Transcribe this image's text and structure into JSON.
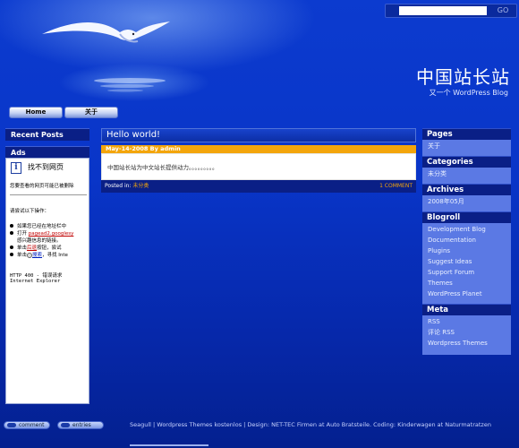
{
  "header": {
    "site_title": "中国站长站",
    "tagline": "又一个 WordPress Blog",
    "search_go": "GO"
  },
  "nav": {
    "home": "Home",
    "about": "关于"
  },
  "left_sidebar": {
    "recent_posts_heading": "Recent Posts",
    "ads_heading": "Ads",
    "ads_content": {
      "title": "找不到网页",
      "intro": "您要查看的网页可能已被删除",
      "try_heading": "请尝试以下操作：",
      "bullet1": "如果您已经在地址栏中",
      "bullet2_prefix": "打开",
      "bullet2_link": "pagead2.googlesy",
      "bullet2_tail": "感兴趣信息的链接。",
      "bullet3_prefix": "单击",
      "bullet3_link": "后退",
      "bullet3_tail": "按钮，尝试",
      "bullet4_prefix": "单击",
      "bullet4_link": "搜索",
      "bullet4_tail": "，寻找 Inte",
      "error_line": "HTTP 400 - 错误请求",
      "browser_line": "Internet Explorer"
    }
  },
  "post": {
    "title": "Hello world!",
    "meta": "May-14-2008 By admin",
    "body": "中国站长站为中文站长提供动力。。。。。。。。。",
    "posted_in_label": "Posted in:",
    "category": "未分类",
    "comments": "1 COMMENT"
  },
  "right_sidebar": {
    "pages_heading": "Pages",
    "pages": [
      "关于"
    ],
    "categories_heading": "Categories",
    "categories": [
      "未分类"
    ],
    "archives_heading": "Archives",
    "archives": [
      "2008年05月"
    ],
    "blogroll_heading": "Blogroll",
    "blogroll": [
      "Development Blog",
      "Documentation",
      "Plugins",
      "Suggest Ideas",
      "Support Forum",
      "Themes",
      "WordPress Planet"
    ],
    "meta_heading": "Meta",
    "meta": [
      "RSS",
      "评论 RSS",
      "Wordpress Themes"
    ]
  },
  "footer": {
    "comment_btn": "comment",
    "entries_btn": "entries",
    "text": "Seagull | Wordpress Themes kostenlos | Design: NET-TEC Firmen at Auto Bratsteile. Coding: Kinderwagen at Naturmatratzen"
  },
  "colors": {
    "background": "#0a2fb6",
    "post_meta_bar": "#f3a50b",
    "sidebar_panel": "#5b79e4",
    "heading_bar": "#0a1f86"
  }
}
